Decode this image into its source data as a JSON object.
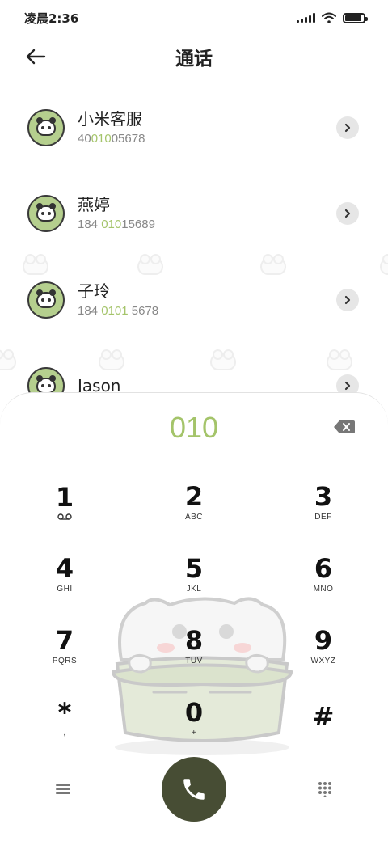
{
  "status_bar": {
    "time": "凌晨2:36",
    "signal_icon": "signal-icon",
    "wifi_icon": "wifi-icon",
    "battery_icon": "battery-icon",
    "battery_level": 0.9
  },
  "header": {
    "title": "通话",
    "back_icon": "arrow-left-icon"
  },
  "contacts": [
    {
      "name": "小米客服",
      "number_pre": "40",
      "number_hl": "010",
      "number_post": "05678"
    },
    {
      "name": "燕婷",
      "number_pre": "184 ",
      "number_hl": "010",
      "number_post": "15689"
    },
    {
      "name": "子玲",
      "number_pre": "184 ",
      "number_hl": "0101",
      "number_post": " 5678"
    },
    {
      "name": "Jason",
      "number_pre": "",
      "number_hl": "",
      "number_post": ""
    }
  ],
  "dialer": {
    "input_value": "010",
    "backspace_icon": "backspace-icon",
    "keys": [
      {
        "digit": "1",
        "letters": "",
        "sub_icon": "voicemail-icon"
      },
      {
        "digit": "2",
        "letters": "ABC"
      },
      {
        "digit": "3",
        "letters": "DEF"
      },
      {
        "digit": "4",
        "letters": "GHI"
      },
      {
        "digit": "5",
        "letters": "JKL"
      },
      {
        "digit": "6",
        "letters": "MNO"
      },
      {
        "digit": "7",
        "letters": "PQRS"
      },
      {
        "digit": "8",
        "letters": "TUV"
      },
      {
        "digit": "9",
        "letters": "WXYZ"
      },
      {
        "digit": "*",
        "letters": ","
      },
      {
        "digit": "0",
        "letters": "+"
      },
      {
        "digit": "#",
        "letters": ""
      }
    ],
    "menu_icon": "menu-icon",
    "call_icon": "phone-icon",
    "keypad_icon": "keypad-icon"
  },
  "colors": {
    "accent": "#a4c46a",
    "avatar_bg": "#b5cf8e",
    "call_button": "#474d34"
  }
}
